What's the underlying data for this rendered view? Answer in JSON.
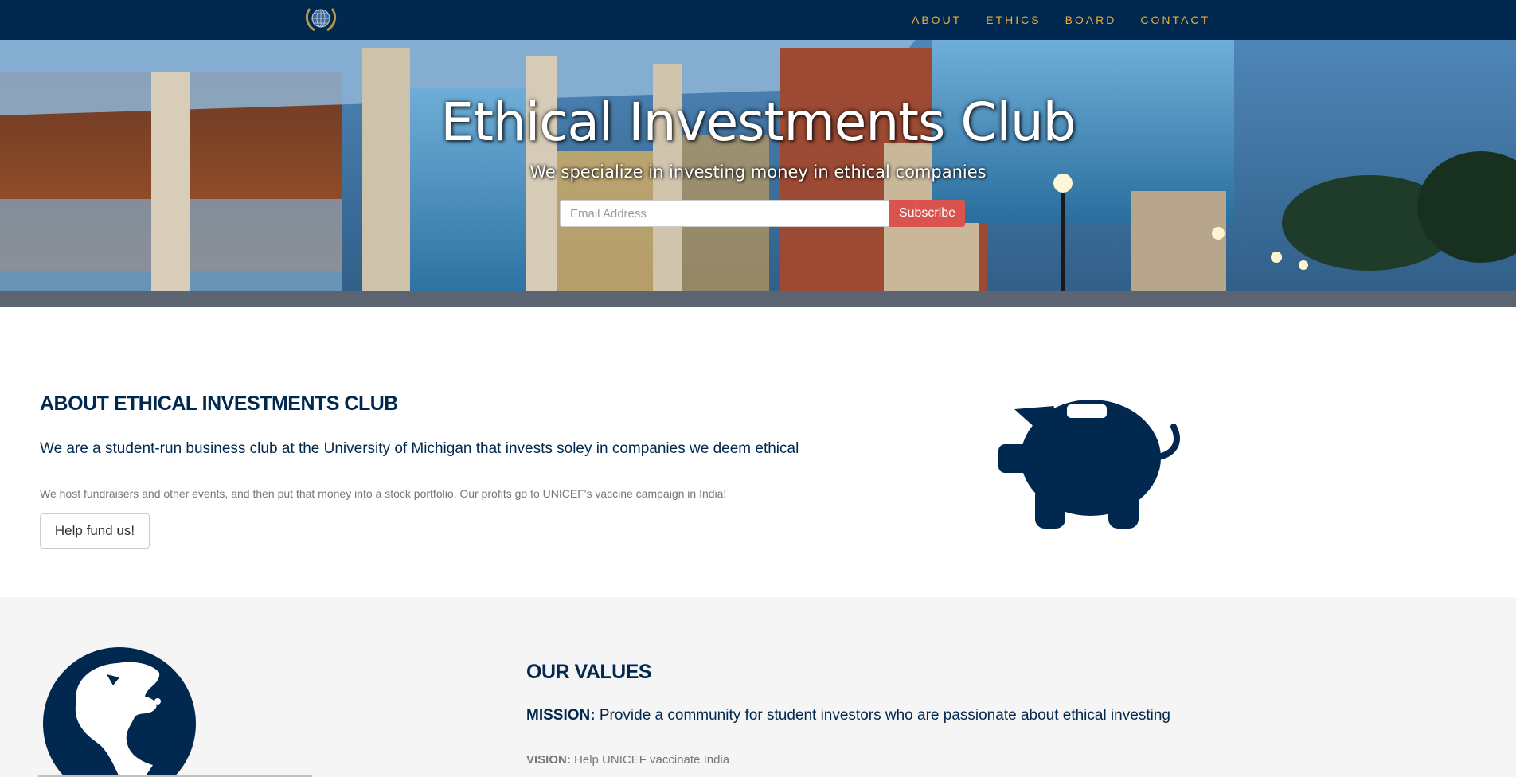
{
  "nav": {
    "items": [
      {
        "label": "ABOUT"
      },
      {
        "label": "ETHICS"
      },
      {
        "label": "BOARD"
      },
      {
        "label": "CONTACT"
      }
    ],
    "logo_icon": "globe-laurel-logo"
  },
  "hero": {
    "title": "Ethical Investments Club",
    "subtitle": "We specialize in investing money in ethical companies",
    "email_placeholder": "Email Address",
    "subscribe_label": "Subscribe"
  },
  "about": {
    "title": "ABOUT ETHICAL INVESTMENTS CLUB",
    "lead": "We are a student-run business club at the University of Michigan that invests soley in companies we deem ethical",
    "text": "We host fundraisers and other events, and then put that money into a stock portfolio. Our profits go to UNICEF's vaccine campaign in India!",
    "button_label": "Help fund us!",
    "icon": "piggy-bank-icon"
  },
  "values": {
    "title": "OUR VALUES",
    "mission_label": "MISSION:",
    "mission_text": "Provide a community for student investors who are passionate about ethical investing",
    "vision_label": "VISION:",
    "vision_text": "Help UNICEF vaccinate India",
    "icon": "globe-icon"
  },
  "colors": {
    "navy": "#01284e",
    "gold": "#f0ad36",
    "subscribe_red": "#d9534f",
    "gray_text": "#777777",
    "values_bg": "#f5f5f5"
  }
}
